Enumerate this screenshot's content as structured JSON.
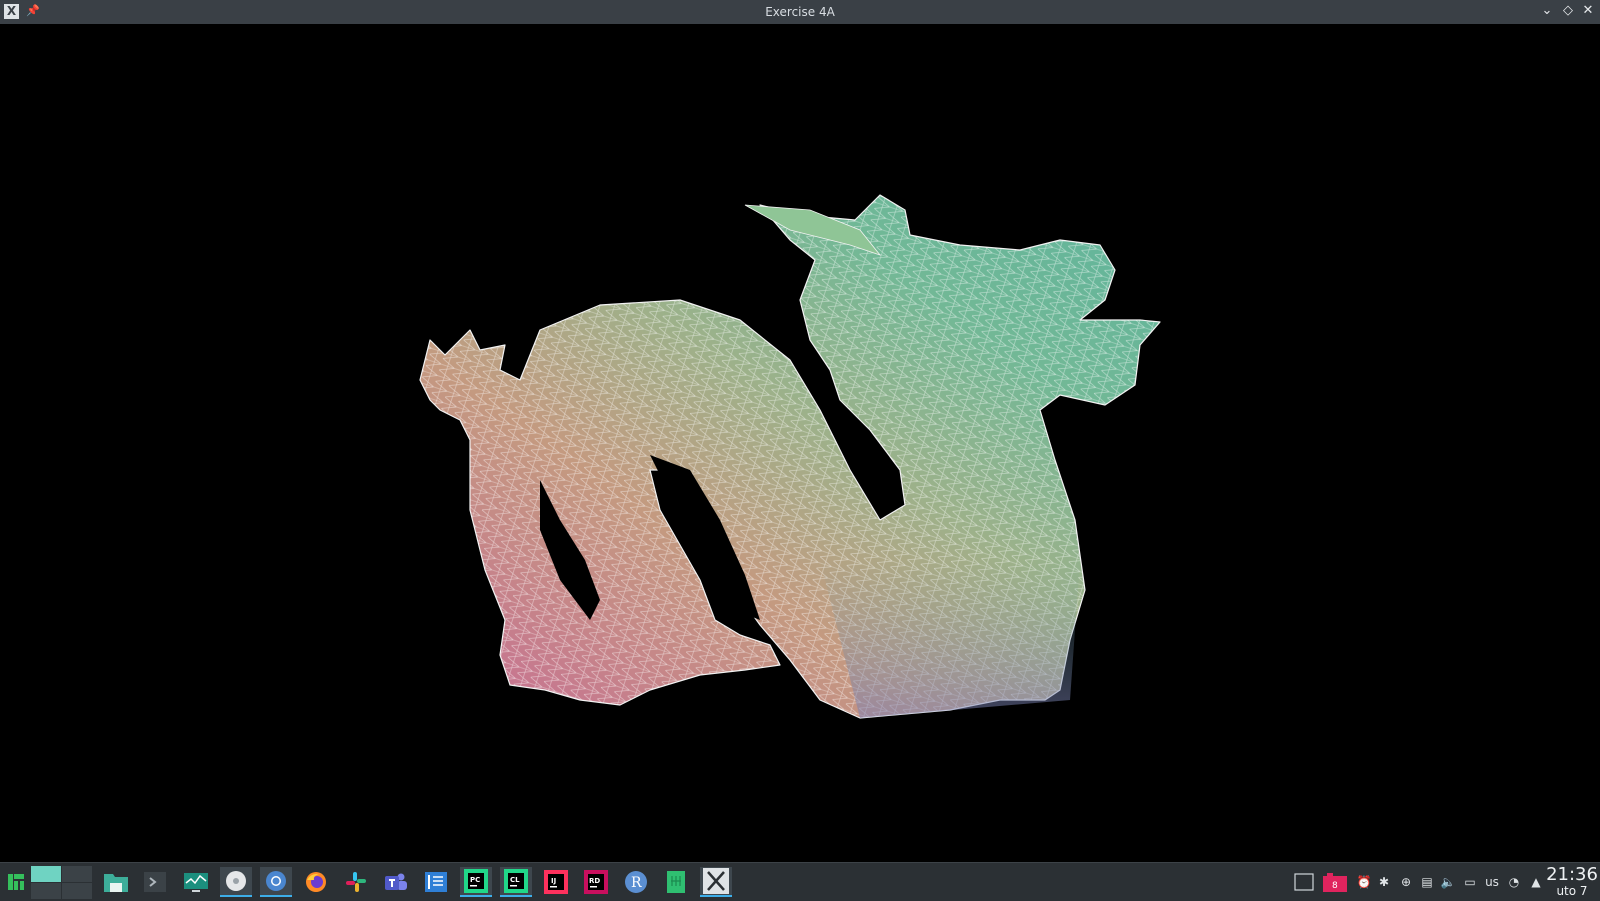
{
  "window": {
    "title": "Exercise 4A",
    "app_icon": "x-window-icon",
    "buttons": [
      "minimize",
      "maximize",
      "close"
    ]
  },
  "viewport": {
    "background": "#000000",
    "content": "stanford-dragon-wireframe"
  },
  "taskbar": {
    "launchers": [
      "manjaro-menu-icon",
      "file-manager-icon",
      "terminal-icon",
      "system-monitor-icon",
      "disk-icon",
      "chromium-icon",
      "firefox-icon",
      "slack-icon",
      "teams-icon",
      "editor-icon",
      "pycharm-icon",
      "clion-icon",
      "intellij-icon",
      "rider-icon",
      "r-icon",
      "gnumeric-icon",
      "x-window-icon"
    ],
    "pycharm_label": "PC",
    "clion_label": "CL",
    "intellij_label": "IJ",
    "rider_label": "RD",
    "r_label": "R",
    "tray": {
      "keyboard_layout": "us"
    },
    "clock": {
      "time": "21:36",
      "date": "uto 7"
    }
  },
  "colors": {
    "titlebar": "#3a4046",
    "taskbar": "#2b3034",
    "accent": "#3daee9",
    "pager_active": "#6fd3c2"
  }
}
